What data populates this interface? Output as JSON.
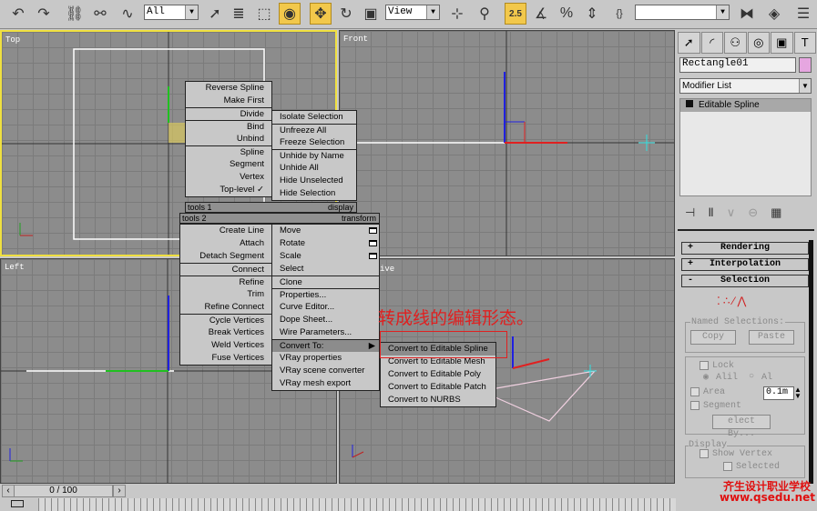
{
  "toolbar": {
    "icons": [
      "undo-icon",
      "redo-icon",
      "select-and-link-icon",
      "unlink-icon",
      "bind-space-warp-icon"
    ],
    "selection_filter": "All",
    "tools": [
      "select-object-icon",
      "select-by-name-icon",
      "rectangular-selection-icon",
      "window-crossing-icon",
      "select-and-move-icon",
      "select-and-rotate-icon",
      "select-and-scale-icon"
    ],
    "reference_coord": "View",
    "snap_value": "2.5",
    "named_selection": ""
  },
  "viewports": {
    "top": "Top",
    "front": "Front",
    "left": "Left",
    "perspective": "ive"
  },
  "annotation": "转成线的编辑形态。",
  "quad_menu": {
    "tools1_label": "tools 1",
    "display_label": "display",
    "tools2_label": "tools 2",
    "transform_label": "transform",
    "tools1": [
      {
        "label": "Reverse Spline"
      },
      {
        "label": "Make First"
      },
      {
        "label": "Divide",
        "sep": true
      },
      {
        "label": "Bind",
        "sep": true
      },
      {
        "label": "Unbind"
      },
      {
        "label": "Spline",
        "sep": true
      },
      {
        "label": "Segment"
      },
      {
        "label": "Vertex"
      },
      {
        "label": "Top-level ✓"
      }
    ],
    "display": [
      {
        "label": "Isolate Selection"
      },
      {
        "label": "Unfreeze All",
        "sep": true
      },
      {
        "label": "Freeze Selection"
      },
      {
        "label": "Unhide by Name",
        "sep": true
      },
      {
        "label": "Unhide All"
      },
      {
        "label": "Hide Unselected"
      },
      {
        "label": "Hide Selection"
      }
    ],
    "tools2": [
      {
        "label": "Create Line"
      },
      {
        "label": "Attach"
      },
      {
        "label": "Detach Segment"
      },
      {
        "label": "Connect",
        "sep": true
      },
      {
        "label": "Refine",
        "sep": true
      },
      {
        "label": "Trim"
      },
      {
        "label": "Refine Connect"
      },
      {
        "label": "Cycle Vertices",
        "sep": true
      },
      {
        "label": "Break Vertices"
      },
      {
        "label": "Weld Vertices"
      },
      {
        "label": "Fuse Vertices"
      }
    ],
    "transform": [
      {
        "label": "Move",
        "box": true
      },
      {
        "label": "Rotate",
        "box": true
      },
      {
        "label": "Scale",
        "box": true
      },
      {
        "label": "Select"
      },
      {
        "label": "Clone",
        "sep": true
      },
      {
        "label": "Properties...",
        "sep": true
      },
      {
        "label": "Curve Editor..."
      },
      {
        "label": "Dope Sheet..."
      },
      {
        "label": "Wire Parameters..."
      },
      {
        "label": "Convert To:",
        "sep": true,
        "hl": true,
        "sub": true
      },
      {
        "label": "VRay properties"
      },
      {
        "label": "VRay scene converter"
      },
      {
        "label": "VRay mesh export"
      }
    ],
    "convert_submenu": [
      {
        "label": "Convert to Editable Spline",
        "hl": true
      },
      {
        "label": "Convert to Editable Mesh"
      },
      {
        "label": "Convert to Editable Poly"
      },
      {
        "label": "Convert to Editable Patch"
      },
      {
        "label": "Convert to NURBS"
      }
    ]
  },
  "panel": {
    "tabs": [
      "create-icon",
      "modify-icon",
      "hierarchy-icon",
      "motion-icon",
      "display-icon",
      "utilities-icon"
    ],
    "object_name": "Rectangle01",
    "object_color": "#e6a6e0",
    "modifier_list": "Modifier List",
    "stack": [
      {
        "label": "Editable Spline",
        "selected": true
      }
    ],
    "rollouts": [
      {
        "sign": "+",
        "label": "Rendering"
      },
      {
        "sign": "+",
        "label": "Interpolation"
      },
      {
        "sign": "-",
        "label": "Selection"
      }
    ],
    "named_selections": "Named Selections:",
    "copy": "Copy",
    "paste": "Paste",
    "lock": "Lock",
    "all": "Alil",
    "al": "Al",
    "area": "Area",
    "area_value": "0.1m",
    "segment": "Segment",
    "select_by": "elect By...",
    "display": "Display",
    "show_vertex": "Show Vertex",
    "selected": "Selected"
  },
  "timeline": {
    "frame": "0 / 100",
    "current": 0,
    "total": 100
  },
  "watermark": {
    "line1": "齐生设计职业学校",
    "line2": "www.qsedu.net"
  },
  "colors": {
    "active_viewport": "#f0e040",
    "menu_bg": "#c8c8c8",
    "highlight": "#f2c84b",
    "annotation": "#e02020"
  }
}
